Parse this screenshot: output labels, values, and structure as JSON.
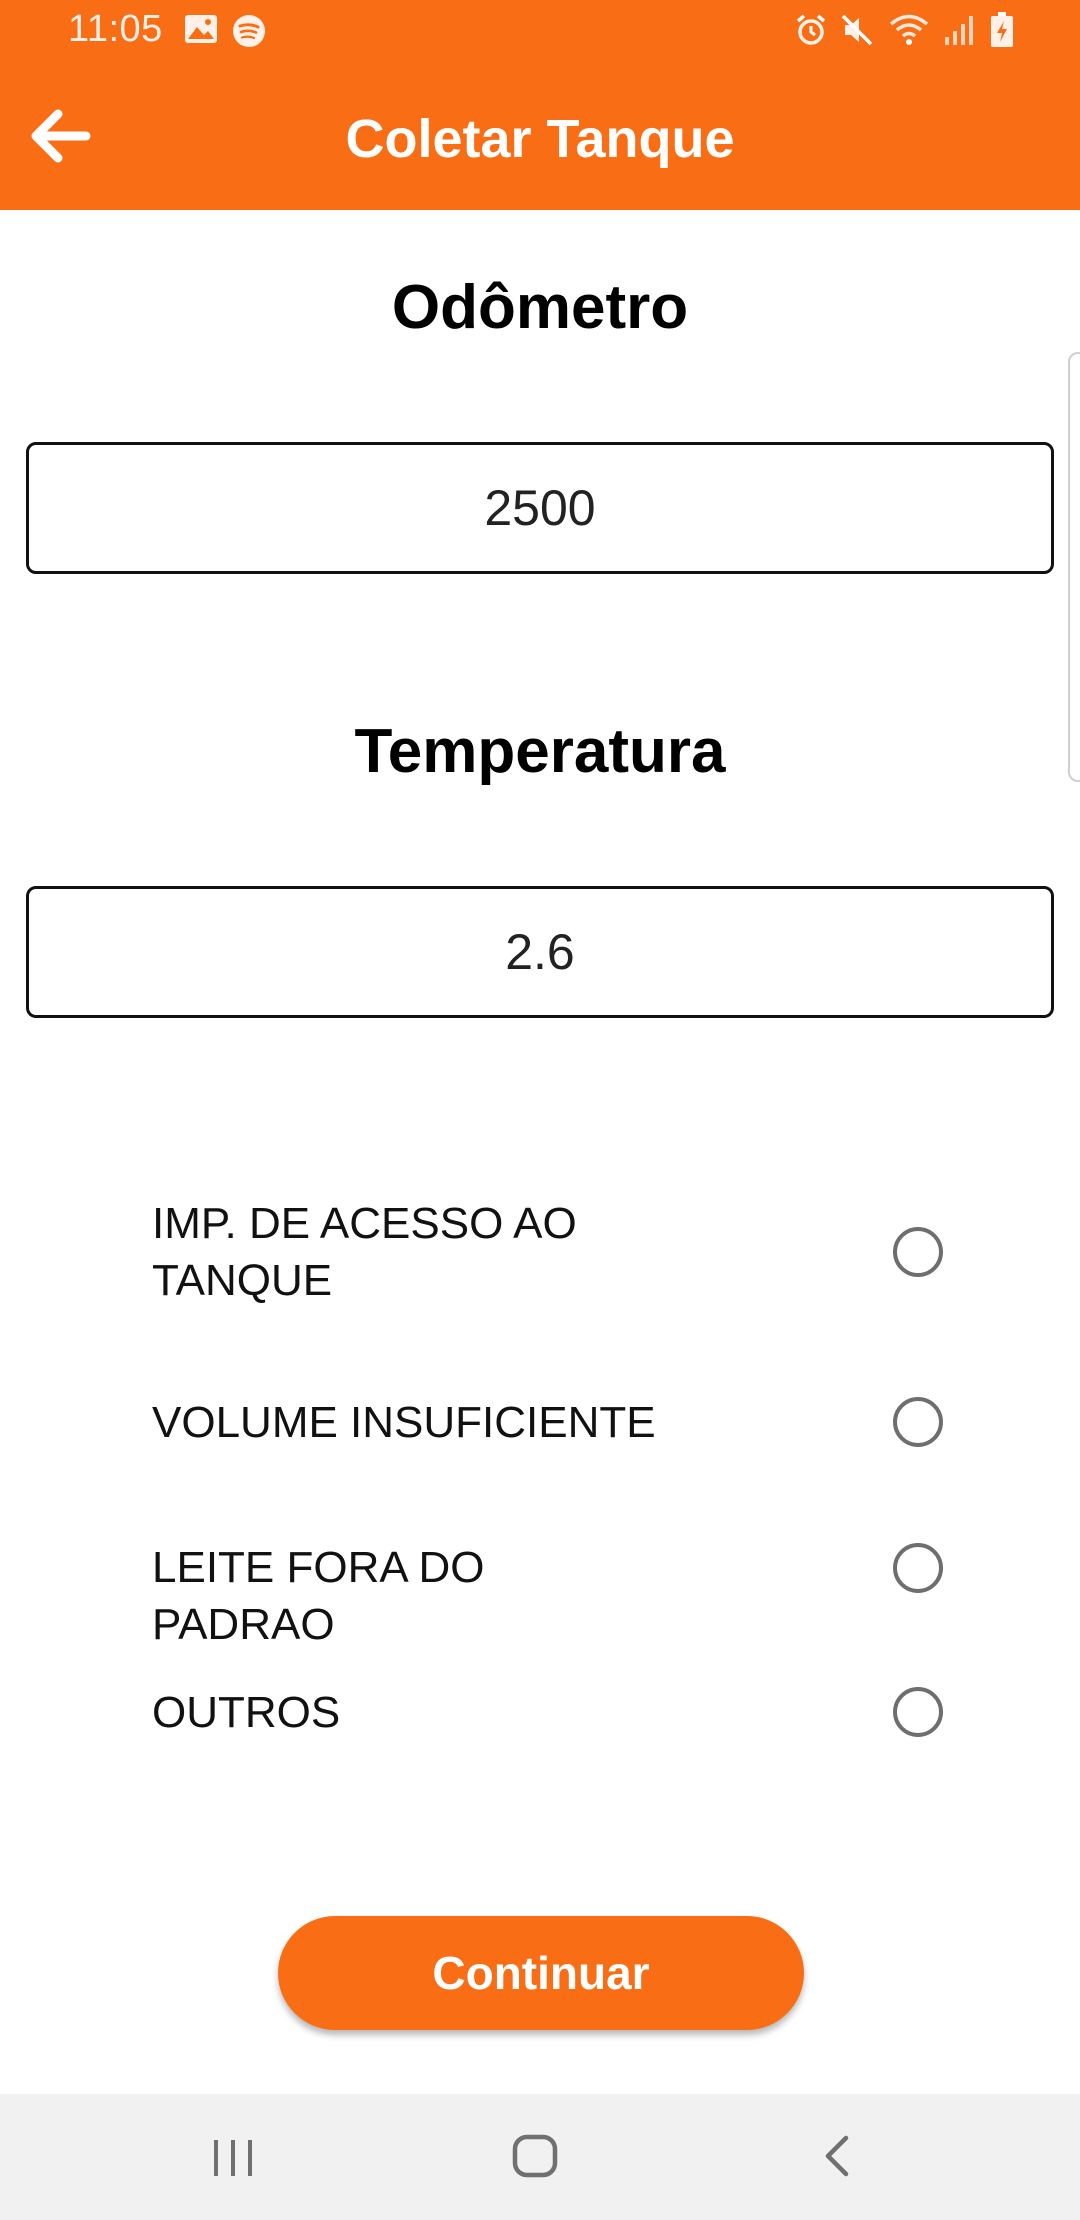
{
  "status_bar": {
    "time": "11:05",
    "left_icons": [
      "gallery-icon",
      "spotify-icon"
    ],
    "right_icons": [
      "alarm-icon",
      "mute-icon",
      "wifi-icon",
      "signal-icon",
      "battery-charging-icon"
    ]
  },
  "app_bar": {
    "title": "Coletar Tanque",
    "back_icon": "arrow-left-icon"
  },
  "form": {
    "odometer": {
      "label": "Odômetro",
      "value": "2500"
    },
    "temperature": {
      "label": "Temperatura",
      "value": "2.6"
    }
  },
  "options": [
    {
      "label": "IMP. DE ACESSO AO TANQUE",
      "selected": false
    },
    {
      "label": "VOLUME INSUFICIENTE",
      "selected": false
    },
    {
      "label": "LEITE FORA DO PADRAO",
      "selected": false
    },
    {
      "label": "OUTROS",
      "selected": false
    }
  ],
  "actions": {
    "continue_label": "Continuar"
  },
  "nav_bar": {
    "icons": [
      "recent-apps-icon",
      "home-icon",
      "back-icon"
    ]
  },
  "colors": {
    "accent": "#f96d14",
    "nav_background": "#f1f1f1",
    "text": "#000000"
  }
}
